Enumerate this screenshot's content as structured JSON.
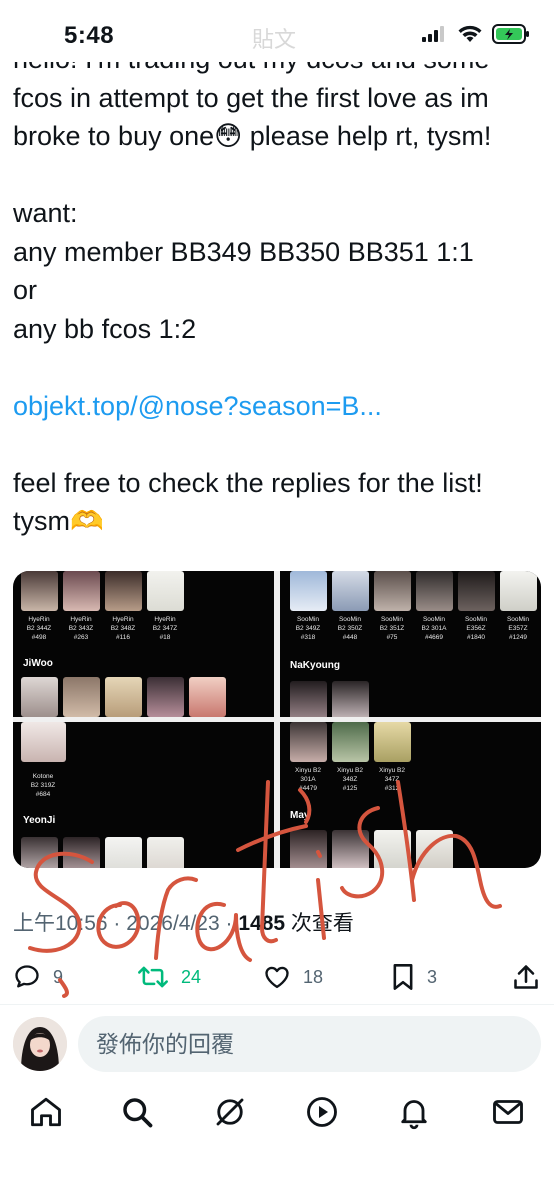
{
  "status_bar": {
    "time": "5:48",
    "header_ghost": "貼文"
  },
  "tweet": {
    "lines": [
      "hello! I'm trading out my dcos and some",
      "fcos in attempt to get the first love as im",
      "broke to buy one😳 please help rt, tysm!",
      "",
      "want:",
      "any member BB349 BB350 BB351 1:1",
      "or",
      "any bb fcos 1:2",
      ""
    ],
    "link": "objekt.top/@nose?season=B...",
    "lines_after": [
      "",
      "feel free to check the replies for the list!",
      "tysm🫶"
    ]
  },
  "media": {
    "panel1": {
      "captions": [
        "HyeRin\nB2 344Z\n#498",
        "HyeRin\nB2 343Z\n#263",
        "HyeRin\nB2 348Z\n#116",
        "HyeRin\nB2 347Z\n#18"
      ],
      "section": "JiWoo"
    },
    "panel2": {
      "captions": [
        "SooMin\nB2 349Z\n#318",
        "SooMin\nB2 350Z\n#448",
        "SooMin\nB2 351Z\n#75",
        "SooMin\nB2 301A\n#4669",
        "SooMin\nE356Z\n#1840",
        "SooMin\nE357Z\n#1249"
      ],
      "section": "NaKyoung"
    },
    "panel3": {
      "captions": [
        "Kotone\nB2 319Z\n#684"
      ],
      "section": "YeonJi"
    },
    "panel4": {
      "captions": [
        "Xinyu B2\n301A\n#4479",
        "Xinyu B2\n348Z\n#125",
        "Xinyu B2\n347Z\n#312"
      ],
      "section": "May"
    }
  },
  "meta": {
    "time": "上午10:56",
    "date": "2026/4/23",
    "views": "1485",
    "views_label": "次查看"
  },
  "actions": {
    "replies": "9",
    "retweets": "24",
    "likes": "18",
    "bookmarks": "3",
    "retweet_color": "#00ba7c"
  },
  "reply_bar": {
    "placeholder": "發佈你的回覆"
  },
  "nav_items": [
    "home-icon",
    "search-icon",
    "grok-icon",
    "video-icon",
    "notifications-icon",
    "messages-icon"
  ],
  "handwriting": {
    "text": "Sorat ish",
    "color": "#d5553e"
  }
}
